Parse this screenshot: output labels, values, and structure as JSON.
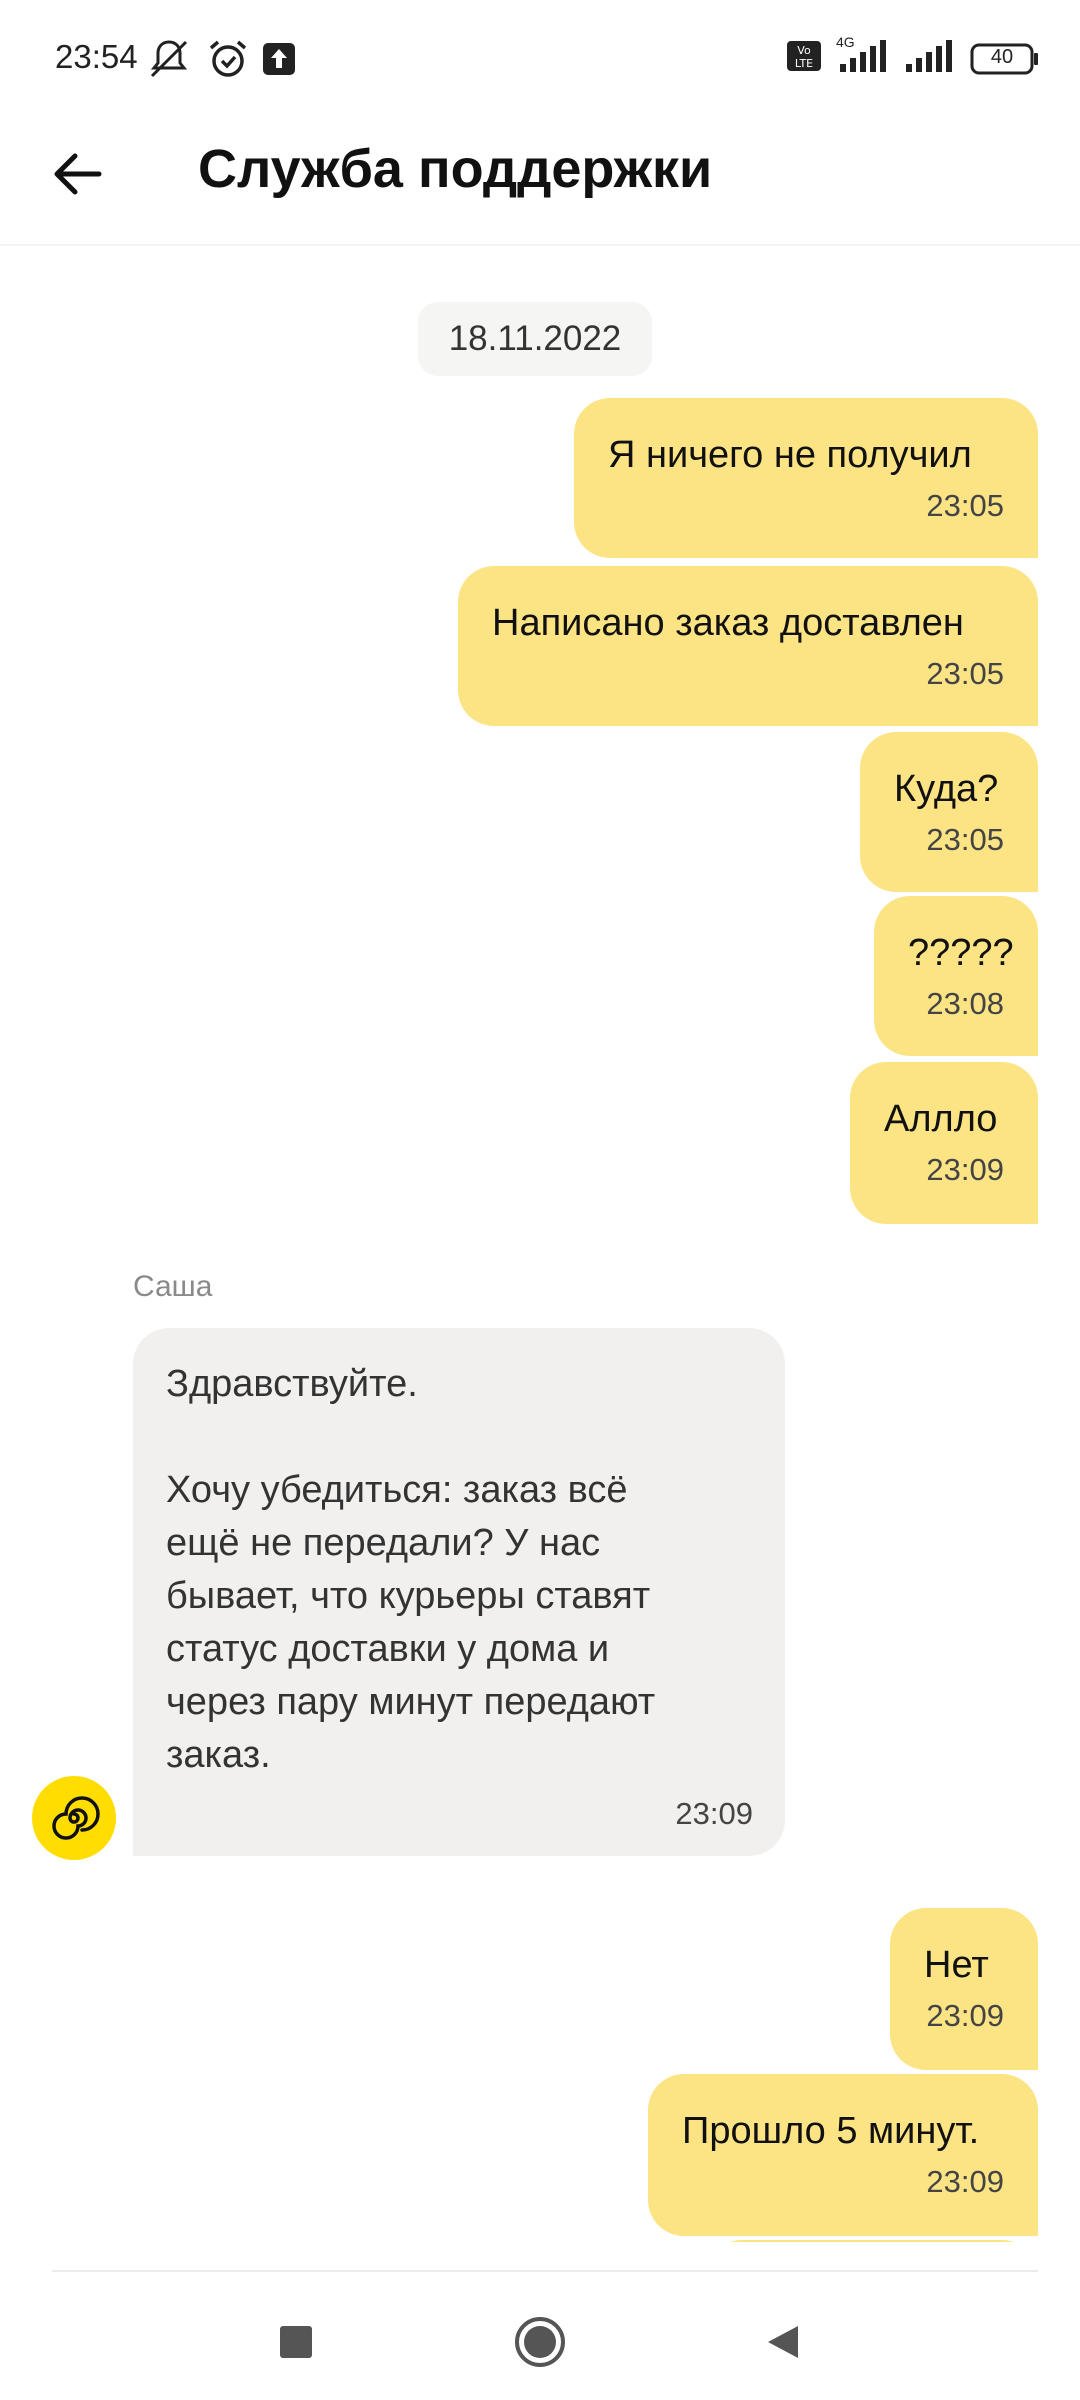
{
  "status_bar": {
    "time": "23:54",
    "left_icons": [
      "muted-bell-icon",
      "alarm-icon",
      "upload-icon"
    ],
    "right_icons": [
      "volte-icon",
      "signal-icon",
      "signal-icon",
      "battery-icon"
    ],
    "network": "4G",
    "battery": "40"
  },
  "header": {
    "title": "Служба поддержки",
    "back_icon": "arrow-left-icon"
  },
  "chat": {
    "date": "18.11.2022",
    "outgoing_top": [
      {
        "text": "Я ничего не получил",
        "time": "23:05"
      },
      {
        "text": "Написано заказ доставлен",
        "time": "23:05"
      },
      {
        "text": "Куда?",
        "time": "23:05"
      },
      {
        "text": "?????",
        "time": "23:08"
      },
      {
        "text": "Аллло",
        "time": "23:09"
      }
    ],
    "agent": {
      "name": "Саша",
      "text": "Здравствуйте.\n\nХочу убедиться: заказ всё\nещё не передали? У нас\nбывает, что курьеры ставят\nстатус доставки у дома и\nчерез пару минут передают\nзаказ.",
      "time": "23:09"
    },
    "outgoing_bottom": [
      {
        "text": "Нет",
        "time": "23:09"
      },
      {
        "text": "Прошло 5 минут.",
        "time": "23:09"
      }
    ]
  },
  "nav": {
    "icons": [
      "recents-square-icon",
      "home-circle-icon",
      "back-triangle-icon"
    ]
  },
  "colors": {
    "outgoing_bubble": "#fce484",
    "incoming_bubble": "#f1f0ee",
    "avatar": "#ffdd00"
  }
}
